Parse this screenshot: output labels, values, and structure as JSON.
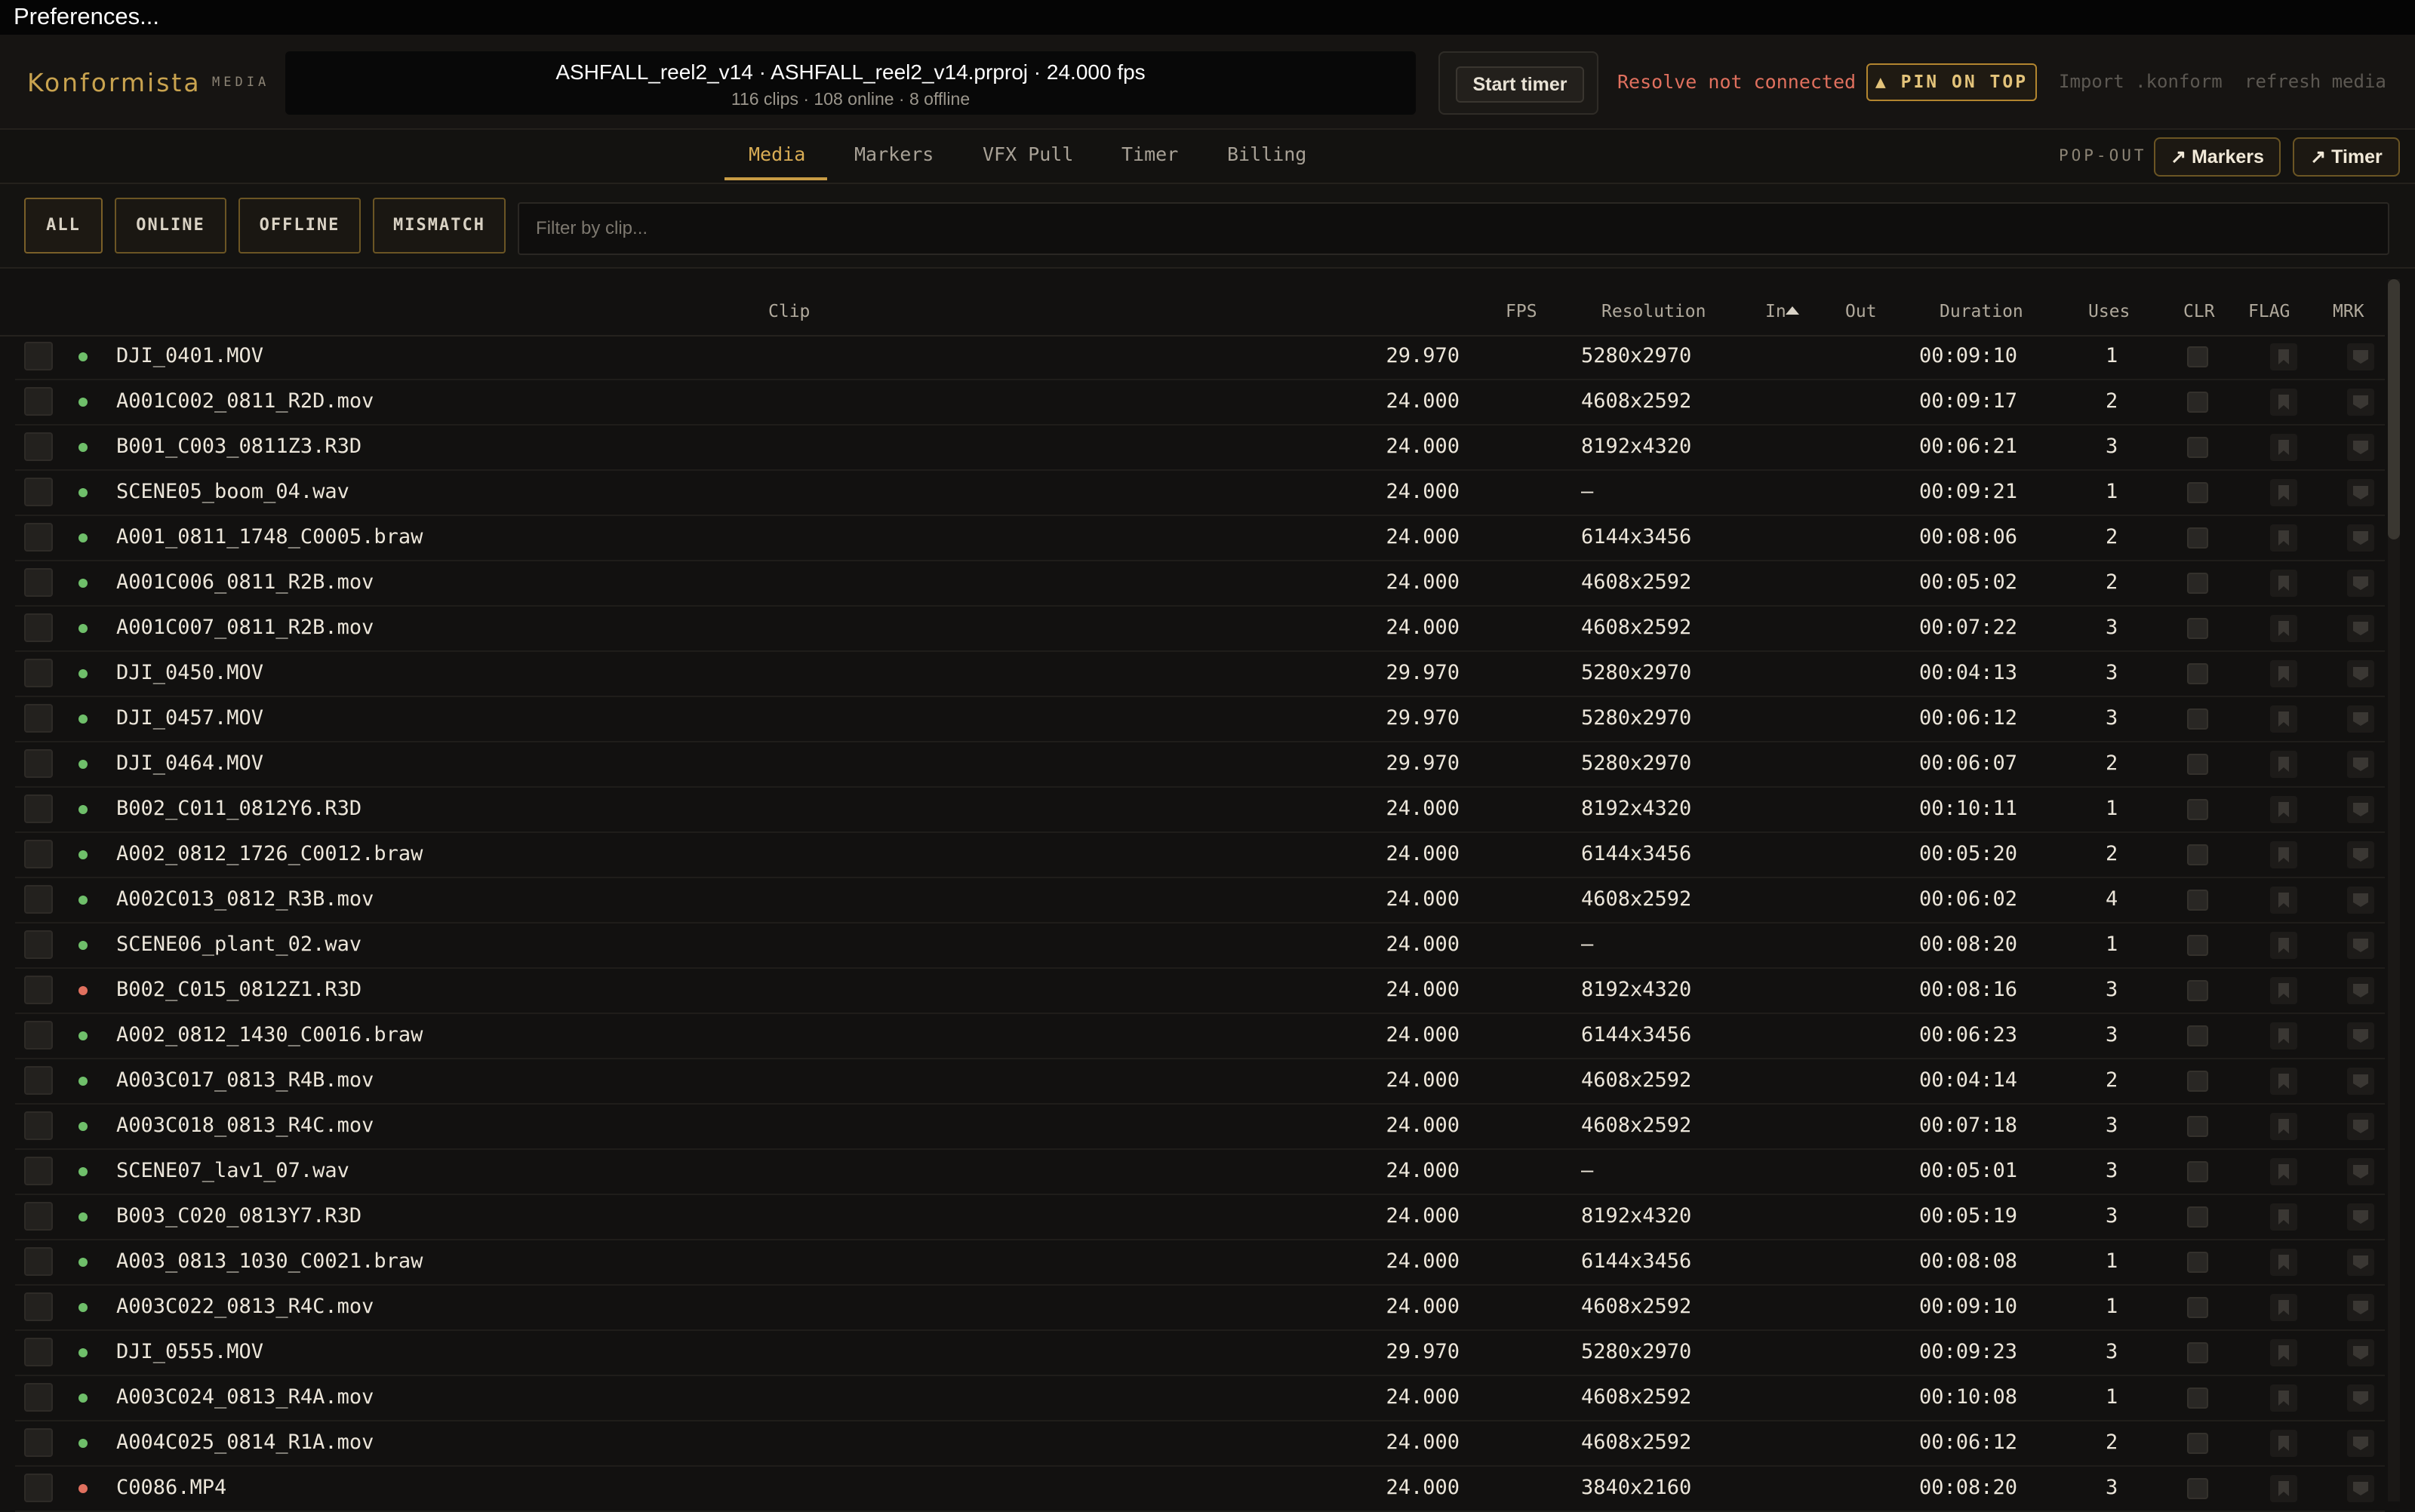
{
  "menubar": {
    "title": "Preferences..."
  },
  "header": {
    "logo": "Konformista",
    "logo_sub": "MEDIA",
    "project_title": "ASHFALL_reel2_v14  ·  ASHFALL_reel2_v14.prproj  ·  24.000 fps",
    "project_stats": "116 clips · 108 online · 8 offline",
    "start_timer": "Start timer",
    "resolve_status": "Resolve not connected",
    "pin_on_top": "▲ PIN ON TOP",
    "import_label": "Import .konform",
    "refresh_label": "refresh media"
  },
  "tabs": [
    {
      "label": "Media",
      "active": true
    },
    {
      "label": "Markers"
    },
    {
      "label": "VFX Pull"
    },
    {
      "label": "Timer"
    },
    {
      "label": "Billing"
    }
  ],
  "popout": {
    "label": "POP-OUT",
    "markers": "↗ Markers",
    "timer": "↗ Timer"
  },
  "filters": {
    "buttons": [
      "ALL",
      "ONLINE",
      "OFFLINE",
      "MISMATCH"
    ],
    "selected": "ALL",
    "placeholder": "Filter by clip..."
  },
  "table": {
    "columns": {
      "clip": "Clip",
      "fps": "FPS",
      "resolution": "Resolution",
      "in": "In",
      "out": "Out",
      "duration": "Duration",
      "uses": "Uses",
      "clr": "CLR",
      "flag": "FLAG",
      "mrk": "MRK"
    },
    "sort_column": "In",
    "rows": [
      {
        "clip": "DJI_0401.MOV",
        "status": "online",
        "fps": "29.970",
        "resolution": "5280x2970",
        "in": "",
        "out": "",
        "duration": "00:09:10",
        "uses": "1"
      },
      {
        "clip": "A001C002_0811_R2D.mov",
        "status": "online",
        "fps": "24.000",
        "resolution": "4608x2592",
        "in": "",
        "out": "",
        "duration": "00:09:17",
        "uses": "2"
      },
      {
        "clip": "B001_C003_0811Z3.R3D",
        "status": "online",
        "fps": "24.000",
        "resolution": "8192x4320",
        "in": "",
        "out": "",
        "duration": "00:06:21",
        "uses": "3"
      },
      {
        "clip": "SCENE05_boom_04.wav",
        "status": "online",
        "fps": "24.000",
        "resolution": "—",
        "in": "",
        "out": "",
        "duration": "00:09:21",
        "uses": "1"
      },
      {
        "clip": "A001_0811_1748_C0005.braw",
        "status": "online",
        "fps": "24.000",
        "resolution": "6144x3456",
        "in": "",
        "out": "",
        "duration": "00:08:06",
        "uses": "2"
      },
      {
        "clip": "A001C006_0811_R2B.mov",
        "status": "online",
        "fps": "24.000",
        "resolution": "4608x2592",
        "in": "",
        "out": "",
        "duration": "00:05:02",
        "uses": "2"
      },
      {
        "clip": "A001C007_0811_R2B.mov",
        "status": "online",
        "fps": "24.000",
        "resolution": "4608x2592",
        "in": "",
        "out": "",
        "duration": "00:07:22",
        "uses": "3"
      },
      {
        "clip": "DJI_0450.MOV",
        "status": "online",
        "fps": "29.970",
        "resolution": "5280x2970",
        "in": "",
        "out": "",
        "duration": "00:04:13",
        "uses": "3"
      },
      {
        "clip": "DJI_0457.MOV",
        "status": "online",
        "fps": "29.970",
        "resolution": "5280x2970",
        "in": "",
        "out": "",
        "duration": "00:06:12",
        "uses": "3"
      },
      {
        "clip": "DJI_0464.MOV",
        "status": "online",
        "fps": "29.970",
        "resolution": "5280x2970",
        "in": "",
        "out": "",
        "duration": "00:06:07",
        "uses": "2"
      },
      {
        "clip": "B002_C011_0812Y6.R3D",
        "status": "online",
        "fps": "24.000",
        "resolution": "8192x4320",
        "in": "",
        "out": "",
        "duration": "00:10:11",
        "uses": "1"
      },
      {
        "clip": "A002_0812_1726_C0012.braw",
        "status": "online",
        "fps": "24.000",
        "resolution": "6144x3456",
        "in": "",
        "out": "",
        "duration": "00:05:20",
        "uses": "2"
      },
      {
        "clip": "A002C013_0812_R3B.mov",
        "status": "online",
        "fps": "24.000",
        "resolution": "4608x2592",
        "in": "",
        "out": "",
        "duration": "00:06:02",
        "uses": "4"
      },
      {
        "clip": "SCENE06_plant_02.wav",
        "status": "online",
        "fps": "24.000",
        "resolution": "—",
        "in": "",
        "out": "",
        "duration": "00:08:20",
        "uses": "1"
      },
      {
        "clip": "B002_C015_0812Z1.R3D",
        "status": "offline",
        "fps": "24.000",
        "resolution": "8192x4320",
        "in": "",
        "out": "",
        "duration": "00:08:16",
        "uses": "3"
      },
      {
        "clip": "A002_0812_1430_C0016.braw",
        "status": "online",
        "fps": "24.000",
        "resolution": "6144x3456",
        "in": "",
        "out": "",
        "duration": "00:06:23",
        "uses": "3"
      },
      {
        "clip": "A003C017_0813_R4B.mov",
        "status": "online",
        "fps": "24.000",
        "resolution": "4608x2592",
        "in": "",
        "out": "",
        "duration": "00:04:14",
        "uses": "2"
      },
      {
        "clip": "A003C018_0813_R4C.mov",
        "status": "online",
        "fps": "24.000",
        "resolution": "4608x2592",
        "in": "",
        "out": "",
        "duration": "00:07:18",
        "uses": "3"
      },
      {
        "clip": "SCENE07_lav1_07.wav",
        "status": "online",
        "fps": "24.000",
        "resolution": "—",
        "in": "",
        "out": "",
        "duration": "00:05:01",
        "uses": "3"
      },
      {
        "clip": "B003_C020_0813Y7.R3D",
        "status": "online",
        "fps": "24.000",
        "resolution": "8192x4320",
        "in": "",
        "out": "",
        "duration": "00:05:19",
        "uses": "3"
      },
      {
        "clip": "A003_0813_1030_C0021.braw",
        "status": "online",
        "fps": "24.000",
        "resolution": "6144x3456",
        "in": "",
        "out": "",
        "duration": "00:08:08",
        "uses": "1"
      },
      {
        "clip": "A003C022_0813_R4C.mov",
        "status": "online",
        "fps": "24.000",
        "resolution": "4608x2592",
        "in": "",
        "out": "",
        "duration": "00:09:10",
        "uses": "1"
      },
      {
        "clip": "DJI_0555.MOV",
        "status": "online",
        "fps": "29.970",
        "resolution": "5280x2970",
        "in": "",
        "out": "",
        "duration": "00:09:23",
        "uses": "3"
      },
      {
        "clip": "A003C024_0813_R4A.mov",
        "status": "online",
        "fps": "24.000",
        "resolution": "4608x2592",
        "in": "",
        "out": "",
        "duration": "00:10:08",
        "uses": "1"
      },
      {
        "clip": "A004C025_0814_R1A.mov",
        "status": "online",
        "fps": "24.000",
        "resolution": "4608x2592",
        "in": "",
        "out": "",
        "duration": "00:06:12",
        "uses": "2"
      },
      {
        "clip": "C0086.MP4",
        "status": "offline",
        "fps": "24.000",
        "resolution": "3840x2160",
        "in": "",
        "out": "",
        "duration": "00:08:20",
        "uses": "3"
      }
    ]
  },
  "colors": {
    "accent": "#c89c45",
    "online": "#6fbf6a",
    "offline": "#e0705e",
    "error_text": "#e0705e"
  },
  "icons": {
    "flag": "bookmark-icon",
    "mrk": "marker-icon",
    "sort": "sort-ascending-icon"
  }
}
